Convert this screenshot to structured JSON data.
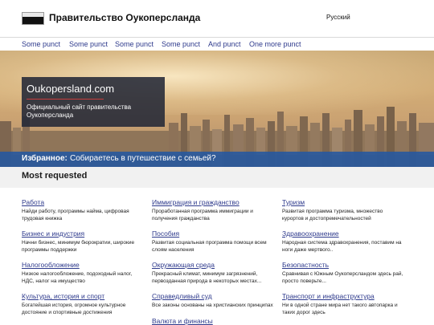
{
  "header": {
    "site_title": "Правительство Оукоперсланда",
    "language": "Русский",
    "flag_colors": {
      "top": "#e8e8e8",
      "middle": "#ffffff",
      "bottom": "#111111"
    }
  },
  "nav": {
    "items": [
      "Some punct",
      "Some punct",
      "Some punct",
      "Some punct",
      "And punct",
      "One more punct"
    ]
  },
  "hero": {
    "title": "Oukopersland.com",
    "description": "Официальный сайт правительства Оукоперсланда"
  },
  "favorites": {
    "label": "Избранное:",
    "text": "Собираетесь в путешествие с семьей?"
  },
  "most_requested": {
    "title": "Most requested",
    "columns": [
      [
        {
          "title": "Работа",
          "desc": "Найди работу, программы найма, цифровая трудовая книжка"
        },
        {
          "title": "Бизнес и индустрия",
          "desc": "Начни бизнес, минимум бюрократии, широкие программы поддержки"
        },
        {
          "title": "Налогообложение",
          "desc": "Низкое налогообложение, подоходный налог, НДС, налог на имущество"
        },
        {
          "title": "Культура, история и спорт",
          "desc": "Богатейшая история, огромное культурное достояние и спортивные достижения"
        }
      ],
      [
        {
          "title": "Иммиграция и гражданство",
          "desc": "Проработанная программа иммиграции и получения гражданства"
        },
        {
          "title": "Пособия",
          "desc": "Развитая социальная программа помощи всем слоям населения"
        },
        {
          "title": "Окружающая среда",
          "desc": "Прекрасный климат, минимум загрязнений, первозданная природа в некоторых местах..."
        },
        {
          "title": "Справедливый суд",
          "desc": "Все законы основаны на христианских принципах"
        },
        {
          "title": "Валюта и финансы",
          "desc": ""
        }
      ],
      [
        {
          "title": "Туризм",
          "desc": "Развитая программа туризма, множество курортов и достопремечательностей"
        },
        {
          "title": "Здравоохранение",
          "desc": "Народная система здравохранения, поставим на ноги даже мертвого.."
        },
        {
          "title": "Безопастность",
          "desc": "Сравнивая с Южным Оукоперсландом здесь рай, просто поверьте..."
        },
        {
          "title": "Транспорт и инфраструктура",
          "desc": "Ни в одной стране мира нет такого автопарка и таких дорог здесь"
        }
      ]
    ]
  },
  "colors": {
    "link": "#2e3a8c",
    "favorites_bar": "#2458a0",
    "intro_box": "#232837",
    "accent_line": "#c73c3c"
  }
}
